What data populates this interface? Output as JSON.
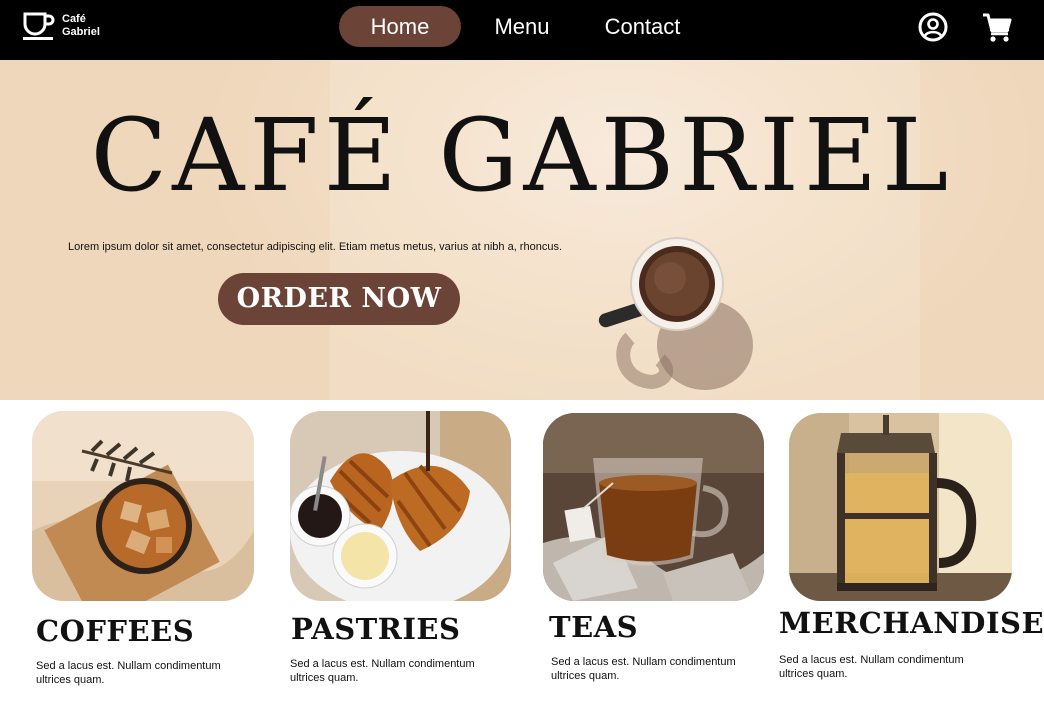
{
  "nav": {
    "brand": {
      "line1": "Café",
      "line2": "Gabriel",
      "icon": "coffee-cup-icon"
    },
    "links": [
      {
        "label": "Home",
        "active": true
      },
      {
        "label": "Menu",
        "active": false
      },
      {
        "label": "Contact",
        "active": false
      }
    ],
    "icons": [
      "account-circle-icon",
      "shopping-cart-icon"
    ]
  },
  "hero": {
    "title": "CAFÉ GABRIEL",
    "description": "Lorem ipsum dolor sit amet, consectetur adipiscing elit. Etiam metus metus, varius at nibh a, rhoncus.",
    "cta_label": "ORDER NOW"
  },
  "categories": [
    {
      "title": "COFFEES",
      "description": "Sed a lacus est. Nullam condimentum ultrices quam."
    },
    {
      "title": "PASTRIES",
      "description": "Sed a lacus est. Nullam condimentum ultrices quam."
    },
    {
      "title": "TEAS",
      "description": "Sed a lacus est. Nullam condimentum ultrices quam."
    },
    {
      "title": "MERCHANDISE",
      "description": "Sed a lacus est. Nullam condimentum ultrices quam."
    }
  ],
  "colors": {
    "nav_bg": "#000000",
    "accent_brown": "#6b4437",
    "hero_bg": "#f3dfc7"
  }
}
